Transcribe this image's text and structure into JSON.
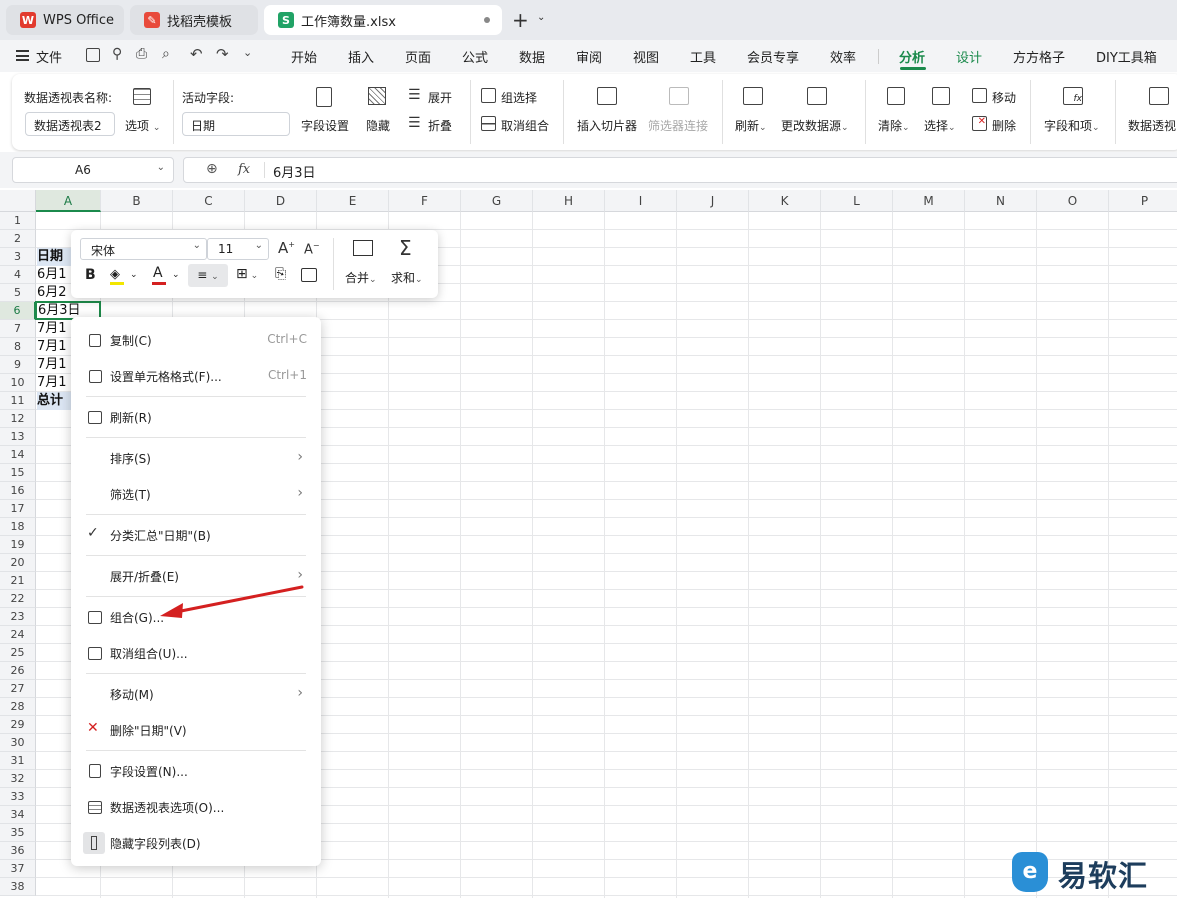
{
  "tabs": [
    {
      "label": "WPS Office",
      "color": "#e23a2e",
      "glyph": "W"
    },
    {
      "label": "找稻壳模板",
      "color": "#e84a3b",
      "glyph": "✎"
    },
    {
      "label": "工作簿数量.xlsx",
      "color": "#21a366",
      "glyph": "S"
    }
  ],
  "menu": {
    "file": "文件",
    "items": [
      "开始",
      "插入",
      "页面",
      "公式",
      "数据",
      "审阅",
      "视图",
      "工具",
      "会员专享",
      "效率",
      "分析",
      "设计",
      "方方格子",
      "DIY工具箱"
    ],
    "selected": "分析"
  },
  "ribbon": {
    "pivot_name_label": "数据透视表名称:",
    "pivot_name_value": "数据透视表2",
    "options": "选项",
    "active_field_label": "活动字段:",
    "active_field_value": "日期",
    "field_settings": "字段设置",
    "hide": "隐藏",
    "expand": "展开",
    "collapse": "折叠",
    "group_selection": "组选择",
    "ungroup": "取消组合",
    "insert_slicer": "插入切片器",
    "filter_connection": "筛选器连接",
    "refresh": "刷新",
    "change_source": "更改数据源",
    "clear": "清除",
    "select": "选择",
    "move": "移动",
    "delete": "删除",
    "fields_items": "字段和项",
    "pivot_chart": "数据透视"
  },
  "formula_bar": {
    "name_box": "A6",
    "fx": "fx",
    "content": "6月3日"
  },
  "columns": [
    "A",
    "B",
    "C",
    "D",
    "E",
    "F",
    "G",
    "H",
    "I",
    "J",
    "K",
    "L",
    "M",
    "N",
    "O",
    "P"
  ],
  "rows": [
    "1",
    "2",
    "3",
    "4",
    "5",
    "6",
    "7",
    "8",
    "9",
    "10",
    "11",
    "12",
    "13",
    "14",
    "15",
    "16",
    "17",
    "18",
    "19",
    "20",
    "21",
    "22",
    "23",
    "24",
    "25",
    "26",
    "27",
    "28",
    "29",
    "30",
    "31",
    "32",
    "33",
    "34",
    "35",
    "36",
    "37",
    "38"
  ],
  "cells": {
    "a3": "日期",
    "a4": "6月1",
    "a5": "6月2",
    "a6": "6月3日",
    "a7": "7月1",
    "a8": "7月1",
    "a9": "7月1",
    "a10": "7月1",
    "a11": "总计"
  },
  "mini_toolbar": {
    "font": "宋体",
    "size": "11",
    "merge": "合并",
    "sum": "求和"
  },
  "context_menu": [
    {
      "label": "复制(C)",
      "shortcut": "Ctrl+C"
    },
    {
      "label": "设置单元格格式(F)...",
      "shortcut": "Ctrl+1"
    },
    {
      "label": "刷新(R)"
    },
    {
      "label": "排序(S)"
    },
    {
      "label": "筛选(T)"
    },
    {
      "label": "分类汇总\"日期\"(B)"
    },
    {
      "label": "展开/折叠(E)"
    },
    {
      "label": "组合(G)..."
    },
    {
      "label": "取消组合(U)..."
    },
    {
      "label": "移动(M)"
    },
    {
      "label": "删除\"日期\"(V)"
    },
    {
      "label": "字段设置(N)..."
    },
    {
      "label": "数据透视表选项(O)..."
    },
    {
      "label": "隐藏字段列表(D)"
    }
  ],
  "watermark": "易软汇",
  "colors": {
    "accent": "#1b8a4c",
    "arrow": "#d42020"
  }
}
